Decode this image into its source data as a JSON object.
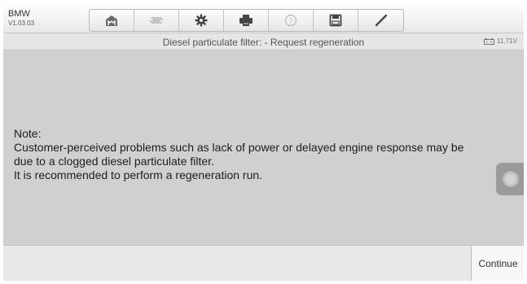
{
  "header": {
    "make": "BMW",
    "version": "V1.03.03",
    "toolbar": [
      {
        "name": "home-icon"
      },
      {
        "name": "vehicle-swap-icon"
      },
      {
        "name": "settings-icon"
      },
      {
        "name": "print-icon"
      },
      {
        "name": "help-icon"
      },
      {
        "name": "save-icon"
      },
      {
        "name": "edit-icon"
      }
    ]
  },
  "titlebar": {
    "title": "Diesel particulate filter: - Request regeneration",
    "battery_voltage": "11.71V"
  },
  "message": {
    "lines": [
      "Note:",
      "Customer-perceived problems such as lack of power or delayed engine response may be",
      "due to a clogged diesel particulate filter.",
      "It is recommended to perform a regeneration run."
    ]
  },
  "footer": {
    "continue_label": "Continue"
  }
}
